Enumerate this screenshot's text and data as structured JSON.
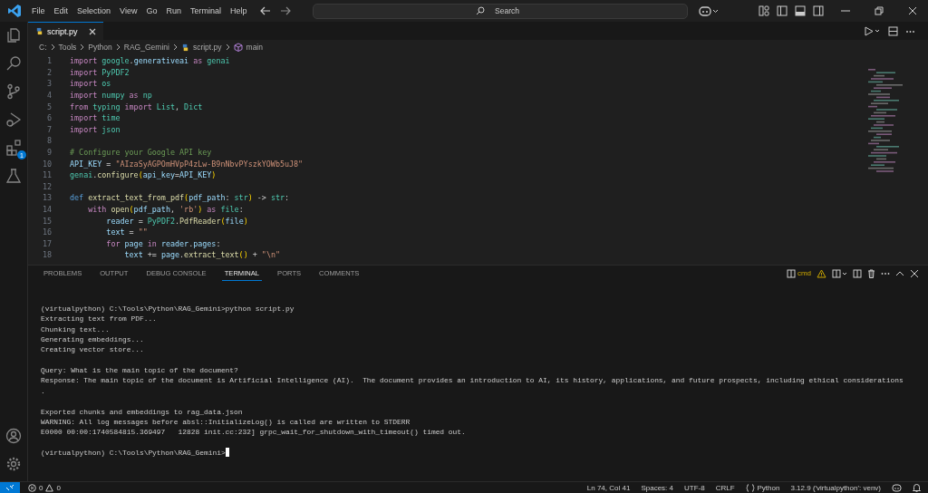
{
  "menu": [
    "File",
    "Edit",
    "Selection",
    "View",
    "Go",
    "Run",
    "Terminal",
    "Help"
  ],
  "search": {
    "placeholder": "Search"
  },
  "activity_bar": {
    "extensions_badge": "1"
  },
  "tabs": [
    {
      "label": "script.py",
      "selected": true
    }
  ],
  "breadcrumb": [
    "C:",
    "Tools",
    "Python",
    "RAG_Gemini",
    "script.py",
    "main"
  ],
  "code": [
    {
      "n": "1",
      "text": "import google.generativeai as genai"
    },
    {
      "n": "2",
      "text": "import PyPDF2"
    },
    {
      "n": "3",
      "text": "import os"
    },
    {
      "n": "4",
      "text": "import numpy as np"
    },
    {
      "n": "5",
      "text": "from typing import List, Dict"
    },
    {
      "n": "6",
      "text": "import time"
    },
    {
      "n": "7",
      "text": "import json"
    },
    {
      "n": "8"
    },
    {
      "n": "9",
      "text": "# Configure your Google API key"
    },
    {
      "n": "10",
      "text": "API_KEY = \"AIzaSyAGPOmHVpP4zLw-B9nNbvPYszkYOWb5uJ8\""
    },
    {
      "n": "11",
      "text": "genai.configure(api_key=API_KEY)"
    },
    {
      "n": "12"
    },
    {
      "n": "13",
      "text": "def extract_text_from_pdf(pdf_path: str) -> str:"
    },
    {
      "n": "14",
      "text": "    with open(pdf_path, 'rb') as file:"
    },
    {
      "n": "15",
      "text": "        reader = PyPDF2.PdfReader(file)"
    },
    {
      "n": "16",
      "text": "        text = \"\""
    },
    {
      "n": "17",
      "text": "        for page in reader.pages:"
    },
    {
      "n": "18",
      "text": "            text += page.extract_text() + \"\\n\""
    }
  ],
  "panel_tabs": [
    {
      "label": "PROBLEMS",
      "selected": false
    },
    {
      "label": "OUTPUT",
      "selected": false
    },
    {
      "label": "DEBUG CONSOLE",
      "selected": false
    },
    {
      "label": "TERMINAL",
      "selected": true
    },
    {
      "label": "PORTS",
      "selected": false
    },
    {
      "label": "COMMENTS",
      "selected": false
    }
  ],
  "terminal_name": "cmd",
  "terminal": [
    [
      "(virtualpython) C:\\Tools\\Python\\RAG_Gemini>python script.py",
      "Extracting text from PDF...",
      "Chunking text...",
      "Generating embeddings...",
      "Creating vector store..."
    ],
    [
      "Query: What is the main topic of the document?",
      "Response: The main topic of the document is Artificial Intelligence (AI).  The document provides an introduction to AI, its history, applications, and future prospects, including ethical considerations",
      "."
    ],
    [
      "Exported chunks and embeddings to rag_data.json",
      "WARNING: All log messages before absl::InitializeLog() is called are written to STDERR",
      "E0000 00:00:1740584815.369497   12828 init.cc:232] grpc_wait_for_shutdown_with_timeout() timed out."
    ],
    [
      "(virtualpython) C:\\Tools\\Python\\RAG_Gemini>"
    ]
  ],
  "status": {
    "errors": "0",
    "warnings": "0",
    "right": [
      "Ln 74, Col 41",
      "Spaces: 4",
      "UTF-8",
      "CRLF"
    ],
    "language": "Python",
    "interpreter": "3.12.9 ('virtualpython': venv)"
  }
}
